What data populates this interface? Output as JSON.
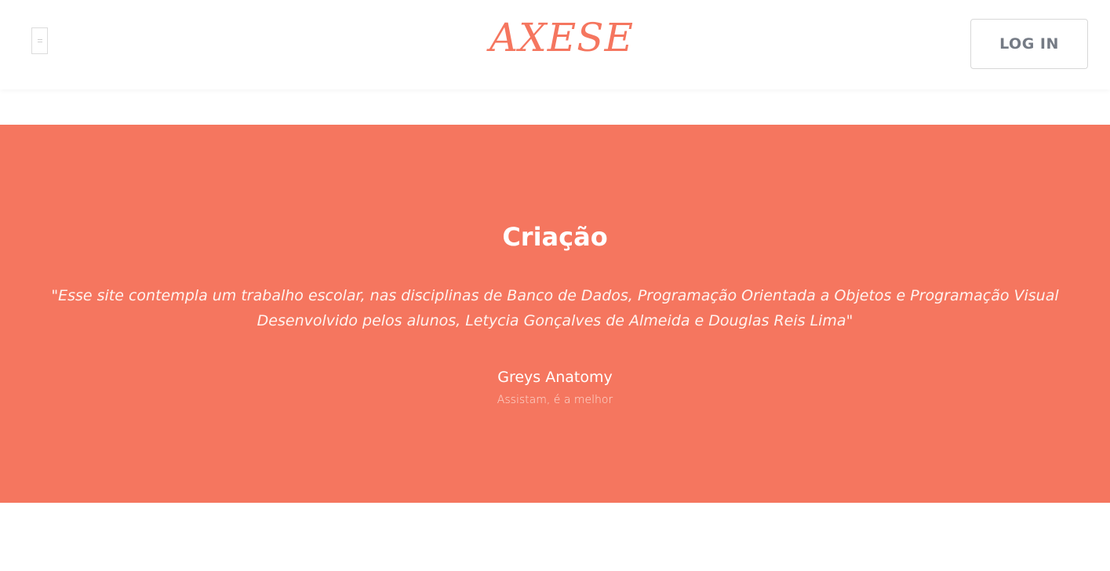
{
  "header": {
    "menu_icon": "hamburger-icon",
    "brand": "AXESE",
    "login_label": "LOG IN"
  },
  "hero": {
    "title": "Criação",
    "quote_line_1": "\"Esse site contempla um trabalho escolar, nas disciplinas de Banco de Dados, Programação Orientada a Objetos e Programação Visual",
    "quote_line_2": "Desenvolvido pelos alunos, Letycia Gonçalves de Almeida e Douglas Reis Lima\"",
    "name": "Greys Anatomy",
    "subtitle": "Assistam, é a melhor"
  },
  "colors": {
    "accent": "#f5765f",
    "header_bg": "#ffffff",
    "button_text": "#757b85"
  }
}
